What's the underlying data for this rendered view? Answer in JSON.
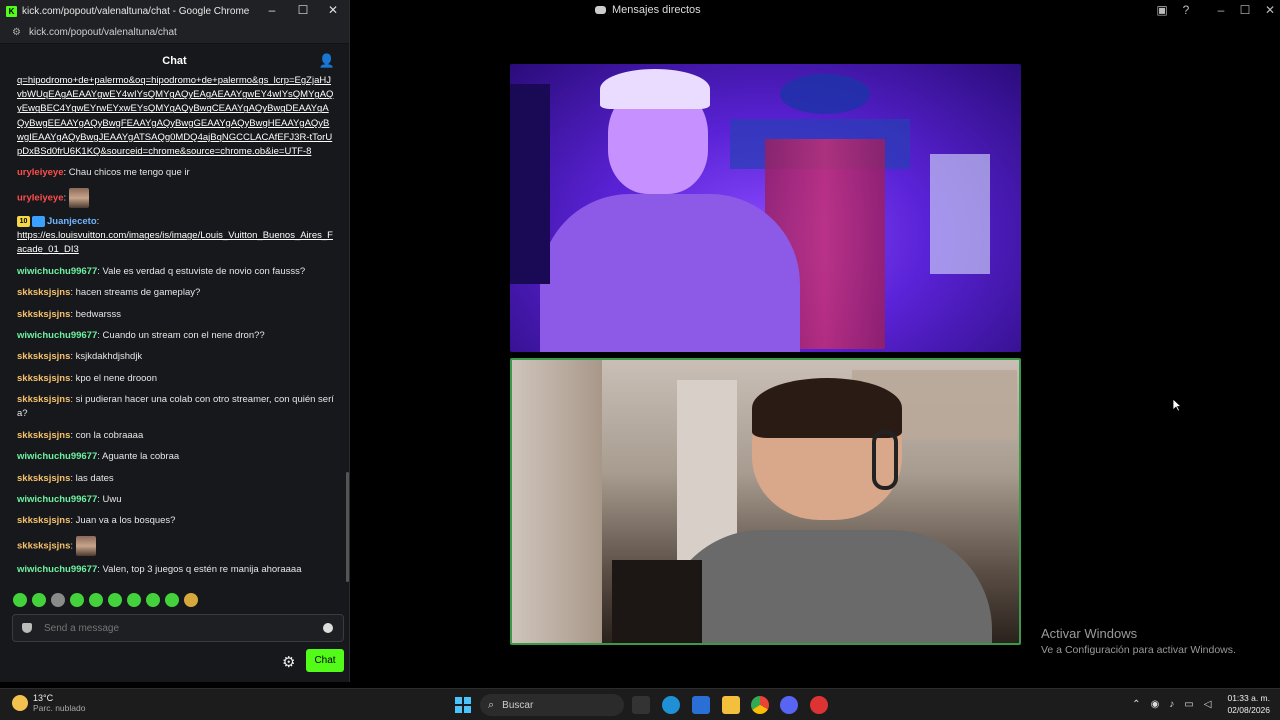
{
  "background": {
    "title": "Mensajes directos",
    "activate": {
      "title": "Activar Windows",
      "subtitle": "Ve a Configuración para activar Windows."
    }
  },
  "chrome": {
    "window_title": "kick.com/popout/valenaltuna/chat - Google Chrome",
    "url": "kick.com/popout/valenaltuna/chat",
    "accent": "#53fc18"
  },
  "chat": {
    "header": "Chat",
    "input_placeholder": "Send a message",
    "send_label": "Chat",
    "link_message": "q=hipodromo+de+palermo&oq=hipodromo+de+palermo&gs_lcrp=EgZjaHJvbWUqEAgAEAAYgwEY4wIYsQMYgAQyEAgAEAAYgwEY4wIYsQMYgAQyEwgBEC4YgwEYrwEYxwEYsQMYgAQyBwgCEAAYgAQyBwgDEAAYgAQyBwgEEAAYgAQyBwgFEAAYgAQyBwgGEAAYgAQyBwgHEAAYgAQyBwgIEAAYgAQyBwgJEAAYgATSAQg0MDQ4ajBqNGCCLACAfEFJ3R-tTorUpDxBSd0frU6K1KQ&sourceid=chrome&source=chrome.ob&ie=UTF-8",
    "messages": [
      {
        "user": "uryleiyeye",
        "color": "red",
        "text": "Chau chicos me tengo que ir"
      },
      {
        "user": "uryleiyeye",
        "color": "red",
        "text": "",
        "emote": "face-emote"
      },
      {
        "user": "Juanjeceto",
        "color": "blue",
        "badge": "10",
        "text": "https://es.louisvuitton.com/images/is/image/Louis_Vuitton_Buenos_Aires_Facade_01_DI3",
        "is_link": true
      },
      {
        "user": "wiwichuchu99677",
        "color": "green",
        "text": "Vale es verdad q estuviste de novio con fausss?"
      },
      {
        "user": "skksksjsjns",
        "color": "yellow",
        "text": "hacen streams de gameplay?"
      },
      {
        "user": "skksksjsjns",
        "color": "yellow",
        "text": "bedwarsss"
      },
      {
        "user": "wiwichuchu99677",
        "color": "green",
        "text": "Cuando un stream con el nene dron??"
      },
      {
        "user": "skksksjsjns",
        "color": "yellow",
        "text": "ksjkdakhdjshdjk"
      },
      {
        "user": "skksksjsjns",
        "color": "yellow",
        "text": "kpo el nene drooon"
      },
      {
        "user": "skksksjsjns",
        "color": "yellow",
        "text": "si pudieran hacer una colab con otro streamer, con quién sería?"
      },
      {
        "user": "skksksjsjns",
        "color": "yellow",
        "text": "con la cobraaaa"
      },
      {
        "user": "wiwichuchu99677",
        "color": "green",
        "text": "Aguante la cobraa"
      },
      {
        "user": "skksksjsjns",
        "color": "yellow",
        "text": "las dates"
      },
      {
        "user": "wiwichuchu99677",
        "color": "green",
        "text": "Uwu"
      },
      {
        "user": "skksksjsjns",
        "color": "yellow",
        "text": "Juan va a los bosques?"
      },
      {
        "user": "skksksjsjns",
        "color": "yellow",
        "text": "",
        "emote": "face-emote"
      },
      {
        "user": "wiwichuchu99677",
        "color": "green",
        "text": "Valen, top 3 juegos q estén re manija ahoraaaa"
      }
    ]
  },
  "taskbar": {
    "weather_temp": "13°C",
    "weather_cond": "Parc. nublado",
    "search_label": "Buscar",
    "time": "01:33 a. m.",
    "date": "02/08/2026"
  }
}
